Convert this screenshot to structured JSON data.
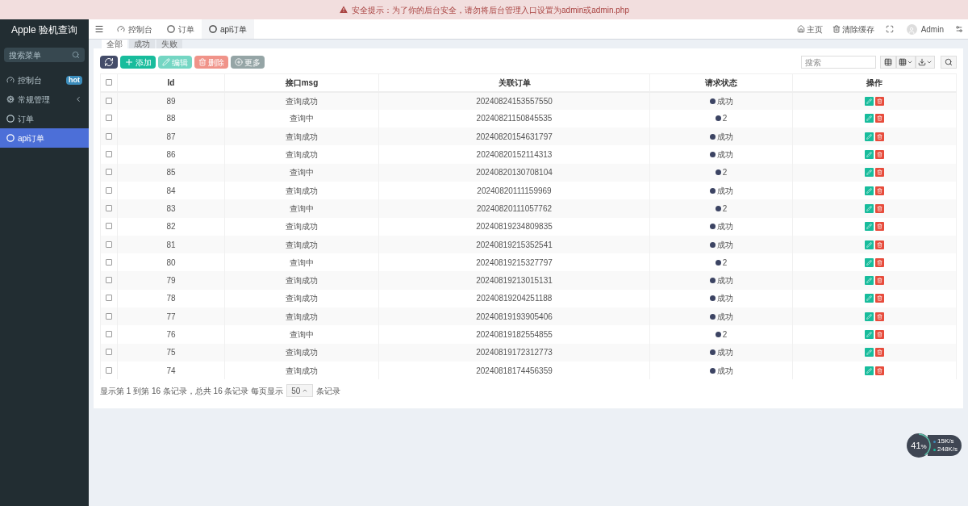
{
  "alert": {
    "text": "安全提示：为了你的后台安全，请勿将后台管理入口设置为admin或admin.php"
  },
  "sidebar": {
    "logo": "Apple 验机查询",
    "search": {
      "placeholder": "搜索菜单"
    },
    "items": [
      {
        "label": "控制台",
        "kind": "dashboard",
        "badge": "hot",
        "selected": false
      },
      {
        "label": "常规管理",
        "kind": "settings",
        "expanded": false,
        "selected": false
      },
      {
        "label": "订单",
        "kind": "page",
        "selected": false
      },
      {
        "label": "api订单",
        "kind": "page",
        "selected": true
      }
    ]
  },
  "header": {
    "tabs": [
      {
        "label": "控制台",
        "kind": "dashboard",
        "selected": false
      },
      {
        "label": "订单",
        "kind": "page",
        "selected": false
      },
      {
        "label": "api订单",
        "kind": "page",
        "selected": true
      }
    ],
    "right": [
      {
        "label": "主页",
        "kind": "home"
      },
      {
        "label": "清除缓存",
        "kind": "clear"
      }
    ],
    "user": "Admin"
  },
  "subtabs": [
    {
      "label": "全部",
      "selected": true
    },
    {
      "label": "成功",
      "selected": false
    },
    {
      "label": "失败",
      "selected": false
    }
  ],
  "toolbar": [
    {
      "kind": "refresh",
      "disabled": false
    },
    {
      "kind": "add",
      "label": "添加",
      "disabled": false
    },
    {
      "kind": "edit",
      "label": "编辑",
      "disabled": true
    },
    {
      "kind": "delete",
      "label": "删除",
      "disabled": true
    },
    {
      "kind": "more",
      "label": "更多",
      "disabled": false
    }
  ],
  "search": {
    "placeholder": "搜索"
  },
  "table": {
    "select_all": false,
    "columns": [
      "Id",
      "接口msg",
      "关联订单",
      "请求状态",
      "操作"
    ],
    "rows": [
      {
        "id": "89",
        "msg": "查询成功",
        "order": "20240824153557550",
        "status": "成功",
        "checked": false
      },
      {
        "id": "88",
        "msg": "查询中",
        "order": "20240821150845535",
        "status": "2",
        "checked": false
      },
      {
        "id": "87",
        "msg": "查询成功",
        "order": "20240820154631797",
        "status": "成功",
        "checked": false
      },
      {
        "id": "86",
        "msg": "查询成功",
        "order": "20240820152114313",
        "status": "成功",
        "checked": false
      },
      {
        "id": "85",
        "msg": "查询中",
        "order": "20240820130708104",
        "status": "2",
        "checked": false
      },
      {
        "id": "84",
        "msg": "查询成功",
        "order": "20240820111159969",
        "status": "成功",
        "checked": false
      },
      {
        "id": "83",
        "msg": "查询中",
        "order": "20240820111057762",
        "status": "2",
        "checked": false
      },
      {
        "id": "82",
        "msg": "查询成功",
        "order": "20240819234809835",
        "status": "成功",
        "checked": false
      },
      {
        "id": "81",
        "msg": "查询成功",
        "order": "20240819215352541",
        "status": "成功",
        "checked": false
      },
      {
        "id": "80",
        "msg": "查询中",
        "order": "20240819215327797",
        "status": "2",
        "checked": false
      },
      {
        "id": "79",
        "msg": "查询成功",
        "order": "20240819213015131",
        "status": "成功",
        "checked": false
      },
      {
        "id": "78",
        "msg": "查询成功",
        "order": "20240819204251188",
        "status": "成功",
        "checked": false
      },
      {
        "id": "77",
        "msg": "查询成功",
        "order": "20240819193905406",
        "status": "成功",
        "checked": false
      },
      {
        "id": "76",
        "msg": "查询中",
        "order": "20240819182554855",
        "status": "2",
        "checked": false
      },
      {
        "id": "75",
        "msg": "查询成功",
        "order": "20240819172312773",
        "status": "成功",
        "checked": false
      },
      {
        "id": "74",
        "msg": "查询成功",
        "order": "20240818174456359",
        "status": "成功",
        "checked": false
      }
    ]
  },
  "pagination": {
    "summary": "显示第 1 到第 16 条记录，总共 16 条记录 每页显示",
    "page_size": "50",
    "suffix": "条记录"
  },
  "speed_widget": {
    "percent": "41",
    "unit": "%",
    "up": "15K/s",
    "down": "248K/s",
    "level": 0.41
  }
}
